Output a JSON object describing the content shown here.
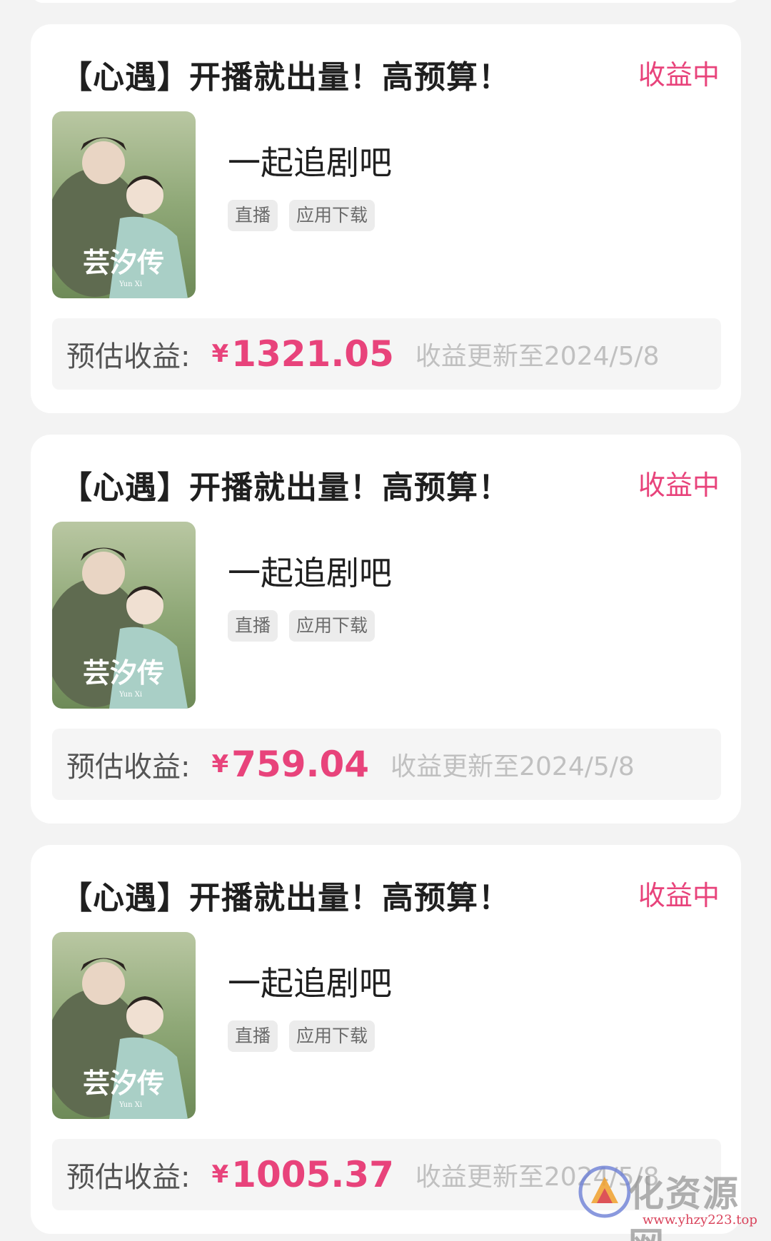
{
  "cards": [
    {
      "title": "【心遇】开播就出量！高预算！",
      "status": "收益中",
      "cover_title": "芸汐传",
      "cover_subtitle": "Yun Xi",
      "app_name": "一起追剧吧",
      "tags": [
        "直播",
        "应用下载"
      ],
      "earnings_label": "预估收益:",
      "currency": "¥",
      "earnings_value": "1321.05",
      "update_text": "收益更新至2024/5/8"
    },
    {
      "title": "【心遇】开播就出量！高预算！",
      "status": "收益中",
      "cover_title": "芸汐传",
      "cover_subtitle": "Yun Xi",
      "app_name": "一起追剧吧",
      "tags": [
        "直播",
        "应用下载"
      ],
      "earnings_label": "预估收益:",
      "currency": "¥",
      "earnings_value": "759.04",
      "update_text": "收益更新至2024/5/8"
    },
    {
      "title": "【心遇】开播就出量！高预算！",
      "status": "收益中",
      "cover_title": "芸汐传",
      "cover_subtitle": "Yun Xi",
      "app_name": "一起追剧吧",
      "tags": [
        "直播",
        "应用下载"
      ],
      "earnings_label": "预估收益:",
      "currency": "¥",
      "earnings_value": "1005.37",
      "update_text": "收益更新至2024/5/8"
    }
  ],
  "watermark": {
    "text": "化资源网",
    "url": "www.yhzy223.top"
  },
  "colors": {
    "accent": "#e8437b",
    "page_bg": "#f3f3f3",
    "card_bg": "#ffffff"
  }
}
